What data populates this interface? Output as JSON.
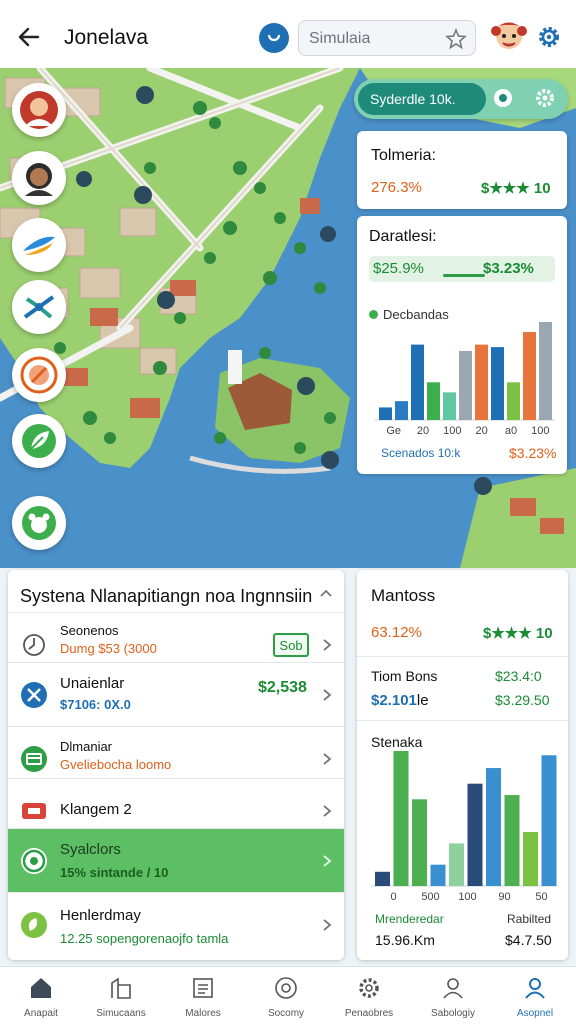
{
  "header": {
    "title": "Jonelava",
    "search_placeholder": "Simulaia"
  },
  "map": {
    "pill_label": "Syderdle 10k.",
    "card_small": {
      "title": "Tolmeria:",
      "left": "276.3%",
      "right": "$★★★ 10"
    },
    "card_chart": {
      "title": "Daratlesi:",
      "bar_left": "$25.9%",
      "bar_right": "$3.23%",
      "bar_progress": 0.6,
      "legend": "Decbandas",
      "footer_left": "Scenados 10:k",
      "footer_right": "$3.23%",
      "ticks": [
        "Ge",
        "20",
        "100",
        "20",
        "a0",
        "100"
      ]
    }
  },
  "chart_data": [
    {
      "type": "bar",
      "categories": [
        "Ge",
        "20",
        "100",
        "20",
        "a0",
        "100"
      ],
      "series": [
        {
          "values": [
            10,
            15,
            60,
            30,
            22,
            55,
            60,
            58,
            30,
            70,
            78
          ]
        }
      ]
    },
    {
      "type": "bar",
      "categories": [
        "0",
        "500",
        "100",
        "90",
        "50"
      ],
      "series": [
        {
          "values": [
            10,
            95,
            61,
            15,
            30,
            72,
            83,
            64,
            38,
            92
          ]
        }
      ]
    }
  ],
  "list": {
    "title": "Systena Nlanapitiangn noa Ingnnsiin",
    "rows": [
      {
        "name": "Seonenos",
        "sub": "Dumg $53 (3000",
        "value": "Sob"
      },
      {
        "name": "Unaienlar",
        "sub": "$7106: 0X.0",
        "value": "$2,538"
      },
      {
        "name": "Dlmaniar",
        "sub": "Gveliebocha loomo",
        "value": ""
      },
      {
        "name": "Klangem 2",
        "sub": "",
        "value": ""
      },
      {
        "name": "Syalclors",
        "sub": "15% sintande  / 10",
        "value": ""
      },
      {
        "name": "Henlerdmay",
        "sub": "12.25 sopengorenaojfo tamla",
        "value": ""
      }
    ]
  },
  "stats": {
    "title": "Mantoss",
    "a": "63.12%",
    "b": "$★★★ 10",
    "c": "Tiom Bons",
    "d": "$23.4:0",
    "e": "$2.101",
    "e_suffix": "le",
    "f": "$3.29.50",
    "g": "Stenaka",
    "h": "Mrenderedar",
    "i": "Rabilted",
    "j": "15.96.Km",
    "k": "$4.7.50"
  },
  "nav": [
    {
      "label": "Anapait",
      "icon": "home-icon"
    },
    {
      "label": "Simucaans",
      "icon": "building-icon"
    },
    {
      "label": "Malores",
      "icon": "document-icon"
    },
    {
      "label": "Socomy",
      "icon": "at-icon"
    },
    {
      "label": "Penaobres",
      "icon": "gear-icon"
    },
    {
      "label": "Sabologiy",
      "icon": "user-icon"
    },
    {
      "label": "Asopnel",
      "icon": "profile-icon"
    }
  ],
  "colors": {
    "accent": "#1f6fb5",
    "green": "#1a8c33",
    "orange": "#e0601b"
  }
}
